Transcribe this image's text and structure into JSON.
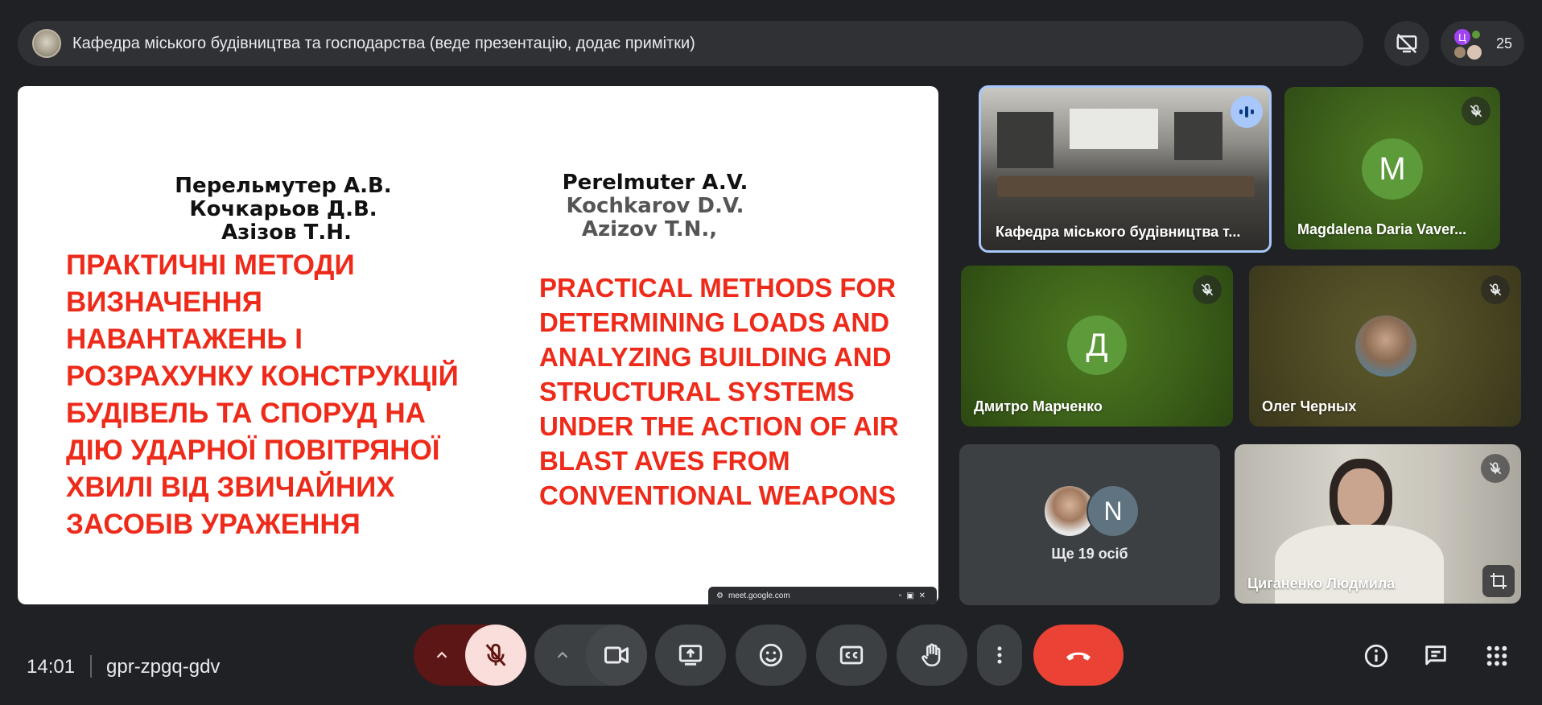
{
  "header": {
    "presenter_title": "Кафедра міського будівництва та господарства (веде презентацію, додає примітки)",
    "participant_count": "25",
    "people_initial": "Ц"
  },
  "slide": {
    "authors_ua": [
      "Перельмутер А.В.",
      "Кочкарьов Д.В.",
      "Азізов Т.Н."
    ],
    "authors_en": [
      "Perelmuter A.V.",
      "Kochkarov D.V.",
      "Azizov T.N.,"
    ],
    "title_ua": [
      "ПРАКТИЧНІ МЕТОДИ",
      "ВИЗНАЧЕННЯ",
      "НАВАНТАЖЕНЬ І",
      "РОЗРАХУНКУ КОНСТРУКЦІЙ",
      "БУДІВЕЛЬ ТА СПОРУД НА",
      "ДІЮ УДАРНОЇ ПОВІТРЯНОЇ",
      "ХВИЛІ ВІД ЗВИЧАЙНИХ",
      "ЗАСОБІВ УРАЖЕННЯ"
    ],
    "title_en": [
      "PRACTICAL METHODS FOR",
      "DETERMINING LOADS AND",
      "ANALYZING BUILDING AND",
      "STRUCTURAL SYSTEMS",
      "UNDER THE ACTION OF AIR",
      "BLAST AVES FROM",
      "CONVENTIONAL WEAPONS"
    ],
    "share_url": "meet.google.com"
  },
  "tiles": {
    "room": {
      "name": "Кафедра міського будівництва т..."
    },
    "magdalena": {
      "name": "Magdalena Daria Vaver...",
      "initial": "M"
    },
    "dmytro": {
      "name": "Дмитро Марченко",
      "initial": "Д"
    },
    "oleg": {
      "name": "Олег Черных"
    },
    "others": {
      "label": "Ще 19 осіб",
      "initial": "N"
    },
    "tsyganenko": {
      "name": "Циганенко Людмила"
    }
  },
  "footer": {
    "time": "14:01",
    "meeting_code": "gpr-zpgq-gdv"
  },
  "colors": {
    "slide_title": "#ee2a1a",
    "leave_button": "#ea4335",
    "mic_off_bg": "#f9dedc",
    "avatar_green": "#5c9a3a"
  }
}
